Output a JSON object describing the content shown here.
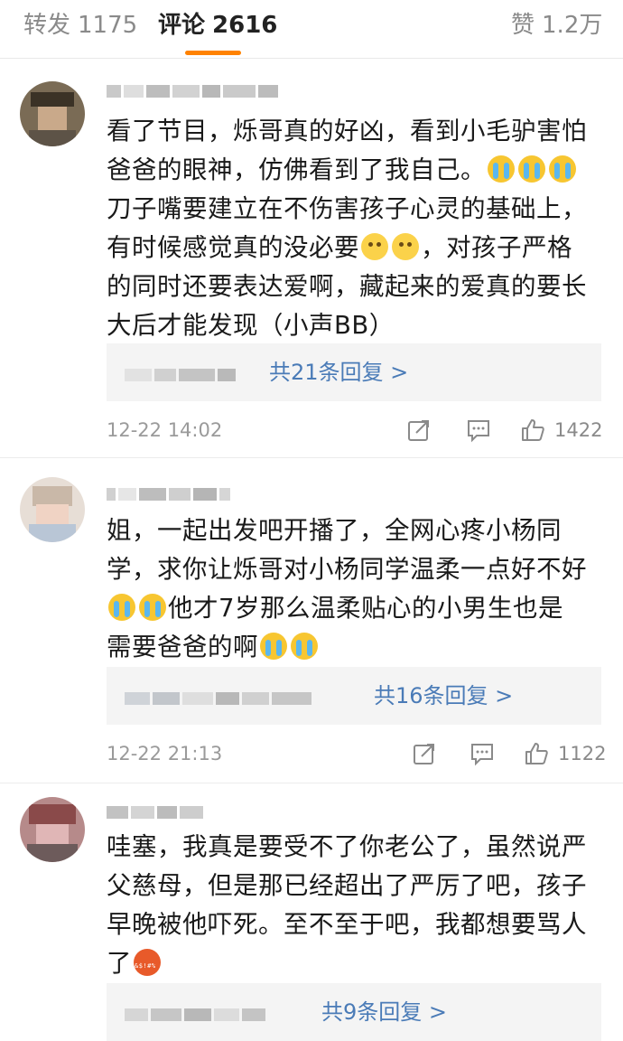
{
  "tabs": {
    "repost": {
      "label": "转发",
      "count": "1175"
    },
    "comment": {
      "label": "评论",
      "count": "2616"
    },
    "like": {
      "label": "赞",
      "count": "1.2万"
    }
  },
  "accent_color": "#ff8200",
  "link_color": "#4a7bb7",
  "comments": [
    {
      "lines": [
        "看了节目，烁哥真的好凶，看到小毛驴害怕",
        "爸爸的眼神，仿佛看到了我自己。",
        "刀子嘴要建立在不伤害孩子心灵的基础上，",
        "有时候感觉真的没必要",
        "，对孩子严格",
        "的同时还要表达爱啊，藏起来的爱真的要长",
        "大后才能发现（小声BB）"
      ],
      "replies_label": "共21条回复 >",
      "time": "12-22 14:02",
      "likes": "1422"
    },
    {
      "lines": [
        "姐，一起出发吧开播了，全网心疼小杨同",
        "学，求你让烁哥对小杨同学温柔一点好不好",
        "他才7岁那么温柔贴心的小男生也是",
        "需要爸爸的啊"
      ],
      "replies_label": "共16条回复 >",
      "time": "12-22 21:13",
      "likes": "1122"
    },
    {
      "lines": [
        "哇塞，我真是要受不了你老公了，虽然说严",
        "父慈母，但是那已经超出了严厉了吧，孩子",
        "早晚被他吓死。至不至于吧，我都想要骂人",
        "了"
      ],
      "replies_label": "共9条回复 >"
    }
  ],
  "icons": [
    "share-icon",
    "reply-icon",
    "thumbs-up-icon",
    "crying-emoji",
    "sad-emoji",
    "angry-emoji"
  ]
}
